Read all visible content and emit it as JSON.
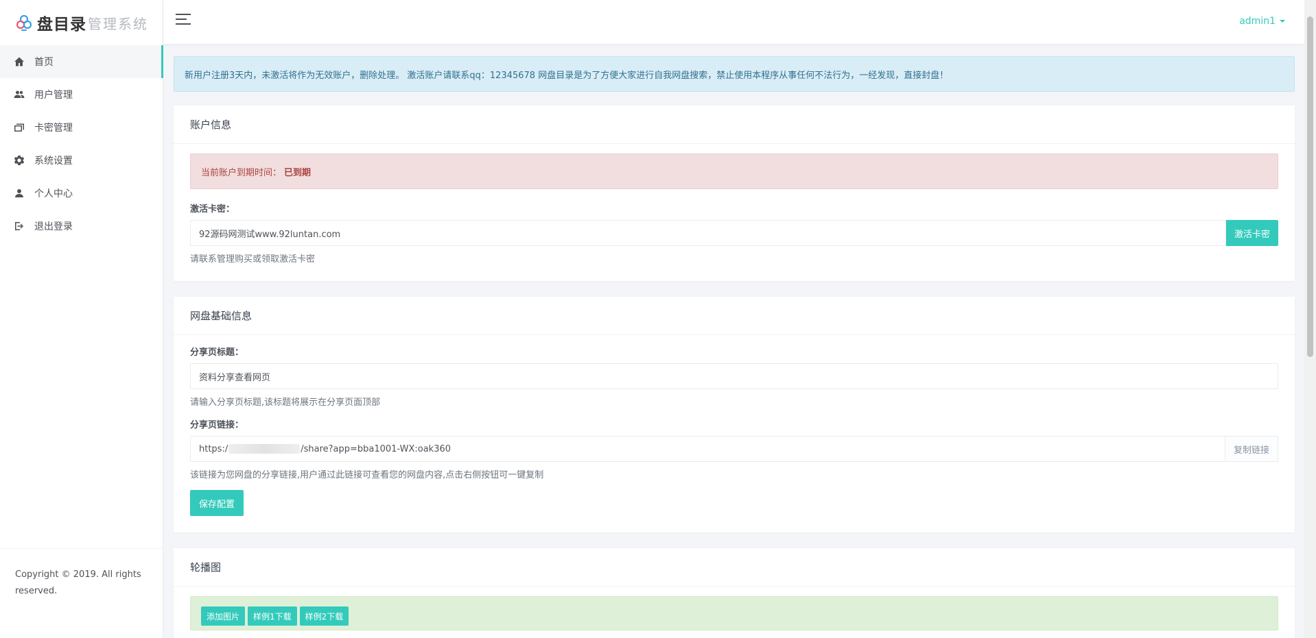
{
  "brand": {
    "name": "盘目录",
    "subtitle": "管理系统"
  },
  "sidebar": {
    "items": [
      {
        "label": "首页",
        "icon": "home-icon",
        "active": true
      },
      {
        "label": "用户管理",
        "icon": "users-icon"
      },
      {
        "label": "卡密管理",
        "icon": "cards-icon"
      },
      {
        "label": "系统设置",
        "icon": "gear-icon"
      },
      {
        "label": "个人中心",
        "icon": "user-icon"
      },
      {
        "label": "退出登录",
        "icon": "logout-icon"
      }
    ],
    "footer": "Copyright © 2019. All rights reserved."
  },
  "header": {
    "user": "admin1"
  },
  "notice": "新用户注册3天内，未激活将作为无效账户，删除处理。 激活账户请联系qq：12345678 网盘目录是为了方便大家进行自我网盘搜索，禁止使用本程序从事任何不法行为，一经发现，直接封盘！",
  "account": {
    "title": "账户信息",
    "expiry_label": "当前账户到期时间：",
    "expiry_value": "已到期",
    "card_label": "激活卡密：",
    "card_value": "92源码网测试www.92luntan.com",
    "activate_button": "激活卡密",
    "card_help": "请联系管理购买或领取激活卡密"
  },
  "netdisk": {
    "title": "网盘基础信息",
    "share_title_label": "分享页标题：",
    "share_title_value": "资料分享查看网页",
    "share_title_help": "请输入分享页标题,该标题将展示在分享页面顶部",
    "share_link_label": "分享页链接：",
    "share_link_prefix": "https:/",
    "share_link_suffix": "/share?app=bba1001-WX:oak360",
    "copy_button": "复制链接",
    "share_link_help": "该链接为您网盘的分享链接,用户通过此链接可查看您的网盘内容,点击右侧按钮可一键复制",
    "save_button": "保存配置"
  },
  "carousel": {
    "title": "轮播图",
    "buttons": [
      "添加图片",
      "样例1下载",
      "样例2下载"
    ]
  },
  "colors": {
    "accent": "#33cabb",
    "info_bg": "#d9edf7",
    "danger_bg": "#f2dede",
    "success_bg": "#dff0d8"
  }
}
